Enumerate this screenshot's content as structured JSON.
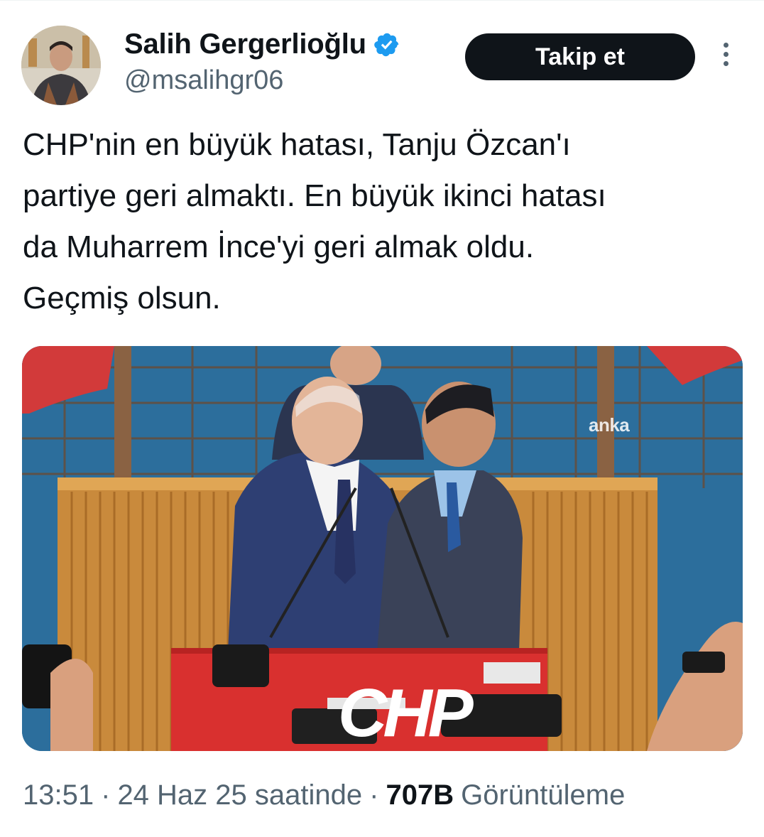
{
  "user": {
    "display_name": "Salih Gergerlioğlu",
    "handle": "@msalihgr06",
    "verified": true,
    "avatar_icon": "profile-photo"
  },
  "actions": {
    "follow_label": "Takip et",
    "more_icon": "vertical-ellipsis-icon"
  },
  "tweet": {
    "text": "CHP'nin en büyük hatası, Tanju Özcan'ı\npartiye geri almaktı. En büyük ikinci hatası\nda Muharrem İnce'yi geri almak oldu.\nGeçmiş olsun."
  },
  "media": {
    "watermark": "anka",
    "podium_text": "CHP"
  },
  "meta": {
    "time": "13:51",
    "date_text": "24 Haz 25 saatinde",
    "separator": "·",
    "views_count": "707B",
    "views_label": "Görüntüleme"
  },
  "colors": {
    "text_primary": "#0f1419",
    "text_secondary": "#536471",
    "verified_blue": "#1d9bf0",
    "follow_bg": "#0f1419"
  }
}
